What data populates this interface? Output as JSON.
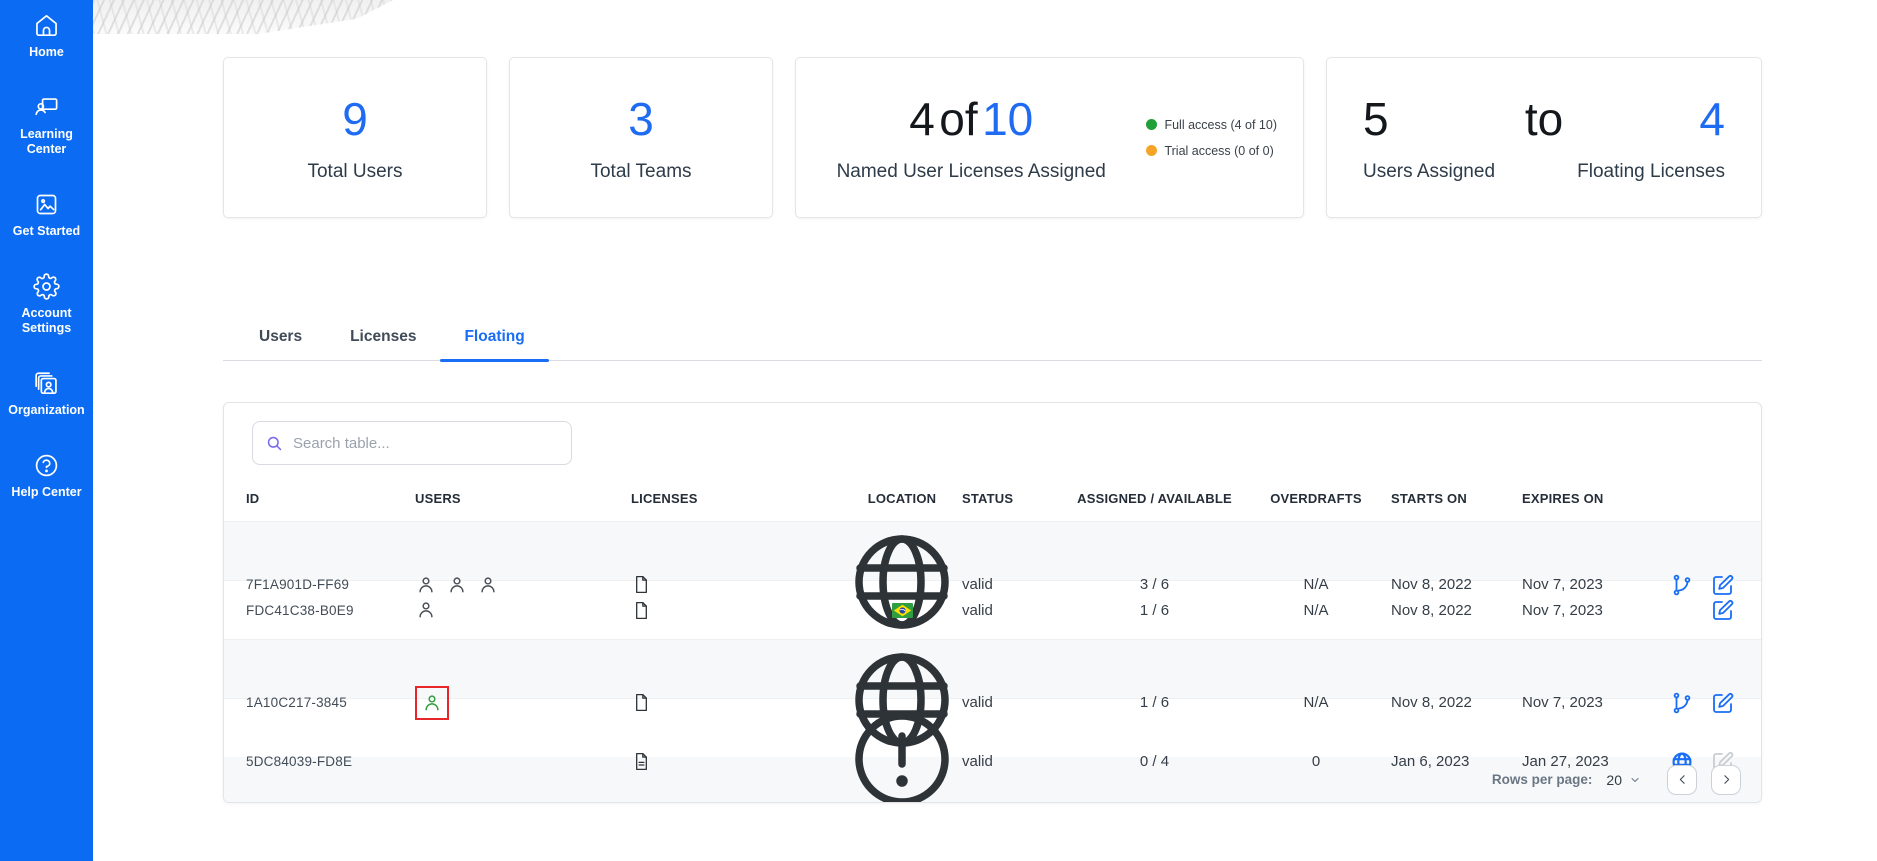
{
  "sidebar": {
    "items": [
      {
        "label": "Home",
        "icon": "home-icon"
      },
      {
        "label": "Learning Center",
        "icon": "learning-center-icon"
      },
      {
        "label": "Get Started",
        "icon": "get-started-icon"
      },
      {
        "label": "Account Settings",
        "icon": "account-settings-icon"
      },
      {
        "label": "Organization",
        "icon": "organization-icon"
      },
      {
        "label": "Help Center",
        "icon": "help-center-icon"
      }
    ]
  },
  "summary_cards": {
    "total_users": {
      "value": "9",
      "label": "Total Users"
    },
    "total_teams": {
      "value": "3",
      "label": "Total Teams"
    },
    "named_licenses": {
      "assigned": "4",
      "of_word": "of",
      "total": "10",
      "label": "Named User Licenses Assigned",
      "legend": [
        {
          "label": "Full access (4 of 10)",
          "color": "#21a038"
        },
        {
          "label": "Trial access (0 of 0)",
          "color": "#f5a428"
        }
      ]
    },
    "floating_summary": {
      "users_assigned_value": "5",
      "to_word": "to",
      "floating_value": "4",
      "users_assigned_label": "Users Assigned",
      "floating_label": "Floating Licenses"
    }
  },
  "tabs": [
    {
      "label": "Users",
      "active": false
    },
    {
      "label": "Licenses",
      "active": false
    },
    {
      "label": "Floating",
      "active": true
    }
  ],
  "table": {
    "search_placeholder": "Search table...",
    "columns": {
      "id": "ID",
      "users": "USERS",
      "licenses": "LICENSES",
      "location": "LOCATION",
      "status": "STATUS",
      "assigned_available": "ASSIGNED / AVAILABLE",
      "overdrafts": "OVERDRAFTS",
      "starts_on": "STARTS ON",
      "expires_on": "EXPIRES ON"
    },
    "rows": [
      {
        "id": "7F1A901D-FF69",
        "users": "3 users",
        "license_icon": "document",
        "location": "global",
        "status": "valid",
        "assigned": "3 / 6",
        "overdrafts": "N/A",
        "starts": "Nov 8, 2022",
        "expires": "Nov 7, 2023",
        "actions": "branch, edit"
      },
      {
        "id": "FDC41C38-B0E9",
        "users": "1 user",
        "license_icon": "document",
        "location": "brazil-flag",
        "status": "valid",
        "assigned": "1 / 6",
        "overdrafts": "N/A",
        "starts": "Nov 8, 2022",
        "expires": "Nov 7, 2023",
        "actions": "edit"
      },
      {
        "id": "1A10C217-3845",
        "users": "1 user (active, highlighted)",
        "license_icon": "document",
        "location": "global",
        "status": "valid",
        "assigned": "1 / 6",
        "overdrafts": "N/A",
        "starts": "Nov 8, 2022",
        "expires": "Nov 7, 2023",
        "actions": "branch, edit"
      },
      {
        "id": "5DC84039-FD8E",
        "users": "none",
        "license_icon": "document-lines",
        "location": "warning",
        "status": "valid",
        "assigned": "0 / 4",
        "overdrafts": "0",
        "starts": "Jan 6, 2023",
        "expires": "Jan 27, 2023",
        "actions": "globe, edit-disabled"
      }
    ],
    "footer": {
      "rows_per_page_label": "Rows per page:",
      "rows_per_page_value": "20"
    }
  },
  "colors": {
    "sidebar_blue": "#0b6cf3",
    "accent_blue": "#1f6bf1",
    "active_user_green": "#2e9e3c",
    "highlight_red": "#e8262a",
    "legend_green": "#21a038",
    "legend_orange": "#f5a428"
  }
}
